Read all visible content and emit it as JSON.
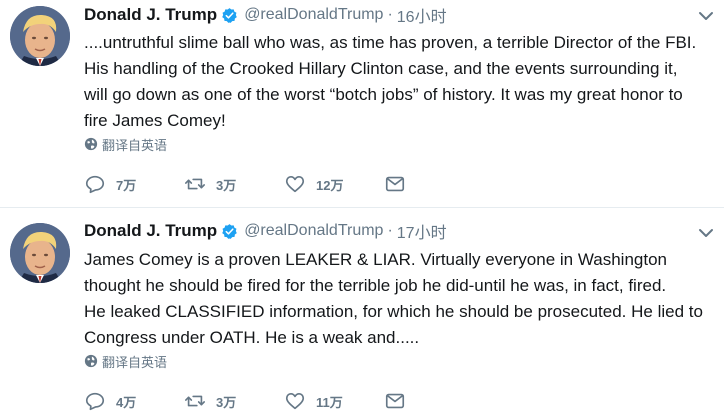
{
  "tweets": [
    {
      "author": {
        "name": "Donald J. Trump",
        "handle": "@realDonaldTrump",
        "avatar_icon": "profile-photo",
        "verified_icon": "verified-badge-icon"
      },
      "separator": "·",
      "time": "16小时",
      "text": "....untruthful slime ball who was, as time has proven, a terrible Director of the FBI.\nHis handling of the Crooked Hillary Clinton case, and the events surrounding it,\nwill go down as one of the worst “botch jobs” of history. It was my great honor to\nfire James Comey!",
      "translate_label": "翻译自英语",
      "actions": {
        "reply_count": "7万",
        "retweet_count": "3万",
        "like_count": "12万"
      }
    },
    {
      "author": {
        "name": "Donald J. Trump",
        "handle": "@realDonaldTrump",
        "avatar_icon": "profile-photo",
        "verified_icon": "verified-badge-icon"
      },
      "separator": "·",
      "time": "17小时",
      "text": "James Comey is a proven LEAKER & LIAR. Virtually everyone in Washington\nthought he should be fired for the terrible job he did-until he was, in fact, fired.\nHe leaked CLASSIFIED information, for which he should be prosecuted. He lied to\nCongress under OATH. He is a weak and.....",
      "translate_label": "翻译自英语",
      "actions": {
        "reply_count": "4万",
        "retweet_count": "3万",
        "like_count": "11万"
      }
    }
  ],
  "colors": {
    "text": "#14171a",
    "secondary": "#657786",
    "verified": "#1da1f2",
    "divider": "#e6ecf0"
  }
}
